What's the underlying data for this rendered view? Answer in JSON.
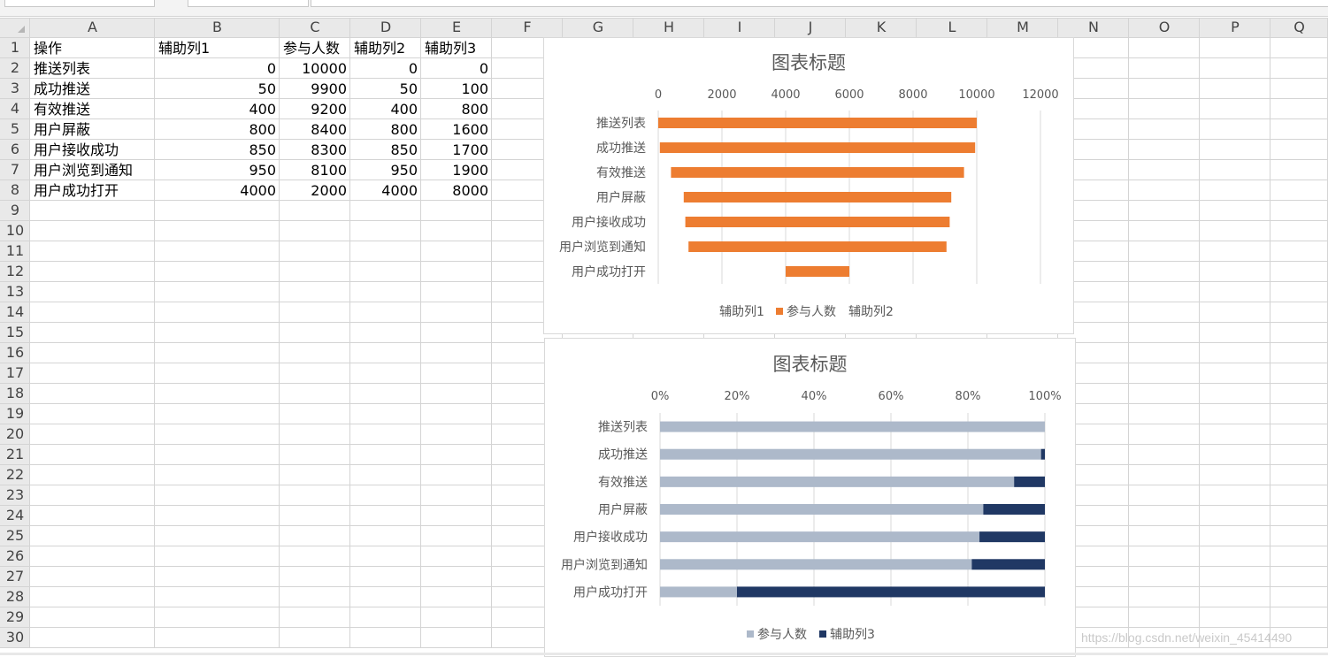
{
  "sheet": {
    "columns": [
      "A",
      "B",
      "C",
      "D",
      "E",
      "F",
      "G",
      "H",
      "I",
      "J",
      "K",
      "L",
      "M",
      "N",
      "O",
      "P",
      "Q"
    ],
    "rows": [
      "1",
      "2",
      "3",
      "4",
      "5",
      "6",
      "7",
      "8",
      "9",
      "10",
      "11",
      "12",
      "13",
      "14",
      "15",
      "16",
      "17",
      "18",
      "19",
      "20",
      "21",
      "22",
      "23",
      "24",
      "25",
      "26",
      "27",
      "28",
      "29",
      "30"
    ],
    "headers": [
      "操作",
      "辅助列1",
      "参与人数",
      "辅助列2",
      "辅助列3"
    ],
    "data": [
      [
        "推送列表",
        "0",
        "10000",
        "0",
        "0"
      ],
      [
        "成功推送",
        "50",
        "9900",
        "50",
        "100"
      ],
      [
        "有效推送",
        "400",
        "9200",
        "400",
        "800"
      ],
      [
        "用户屏蔽",
        "800",
        "8400",
        "800",
        "1600"
      ],
      [
        "用户接收成功",
        "850",
        "8300",
        "850",
        "1700"
      ],
      [
        "用户浏览到通知",
        "950",
        "8100",
        "950",
        "1900"
      ],
      [
        "用户成功打开",
        "4000",
        "2000",
        "4000",
        "8000"
      ]
    ]
  },
  "chart_data": [
    {
      "type": "bar",
      "orientation": "horizontal",
      "stacked": true,
      "title": "图表标题",
      "categories": [
        "推送列表",
        "成功推送",
        "有效推送",
        "用户屏蔽",
        "用户接收成功",
        "用户浏览到通知",
        "用户成功打开"
      ],
      "series": [
        {
          "name": "辅助列1",
          "values": [
            0,
            50,
            400,
            800,
            850,
            950,
            4000
          ],
          "color": "transparent"
        },
        {
          "name": "参与人数",
          "values": [
            10000,
            9900,
            9200,
            8400,
            8300,
            8100,
            2000
          ],
          "color": "#ed7d31"
        },
        {
          "name": "辅助列2",
          "values": [
            0,
            50,
            400,
            800,
            850,
            950,
            4000
          ],
          "color": "transparent"
        }
      ],
      "xlim": [
        0,
        12000
      ],
      "xticks": [
        "0",
        "2000",
        "4000",
        "6000",
        "8000",
        "10000",
        "12000"
      ],
      "axis_position": "top",
      "grid": true,
      "legend": "bottom"
    },
    {
      "type": "bar",
      "orientation": "horizontal",
      "stacked": true,
      "percent": true,
      "title": "图表标题",
      "categories": [
        "推送列表",
        "成功推送",
        "有效推送",
        "用户屏蔽",
        "用户接收成功",
        "用户浏览到通知",
        "用户成功打开"
      ],
      "series": [
        {
          "name": "参与人数",
          "values": [
            10000,
            9900,
            9200,
            8400,
            8300,
            8100,
            2000
          ],
          "color": "#adb9ca"
        },
        {
          "name": "辅助列3",
          "values": [
            0,
            100,
            800,
            1600,
            1700,
            1900,
            8000
          ],
          "color": "#203864"
        }
      ],
      "xlim": [
        0,
        100
      ],
      "xticks": [
        "0%",
        "20%",
        "40%",
        "60%",
        "80%",
        "100%"
      ],
      "axis_position": "top",
      "grid": true,
      "legend": "bottom"
    }
  ],
  "watermark": "https://blog.csdn.net/weixin_45414490"
}
